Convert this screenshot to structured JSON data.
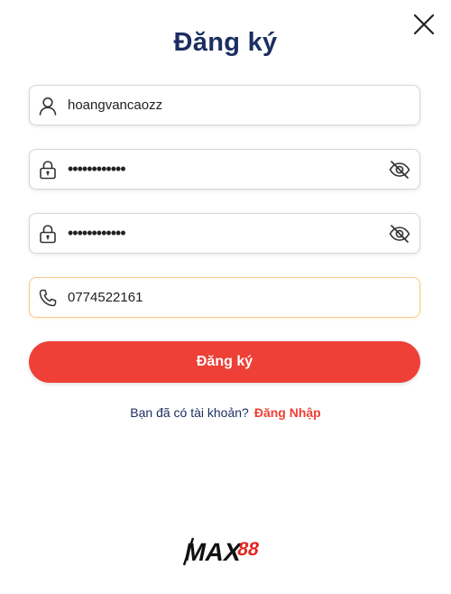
{
  "dialog": {
    "title": "Đăng ký",
    "close_icon": "close-icon"
  },
  "form": {
    "username": {
      "value": "hoangvancaozz",
      "icon": "user-icon"
    },
    "password": {
      "value": "••••••••••••",
      "icon": "lock-icon",
      "toggle_icon": "eye-off-icon"
    },
    "confirm_password": {
      "value": "••••••••••••",
      "icon": "lock-icon",
      "toggle_icon": "eye-off-icon"
    },
    "phone": {
      "value": "0774522161",
      "icon": "phone-icon"
    },
    "submit_label": "Đăng ký"
  },
  "login_prompt": {
    "question": "Bạn đã có tài khoản?",
    "link": "Đăng Nhập"
  },
  "logo": {
    "text": "MAX88"
  },
  "colors": {
    "title": "#1c2e61",
    "accent": "#ee4036",
    "focus_border": "#f7c98b",
    "border": "#d7d7d7"
  }
}
